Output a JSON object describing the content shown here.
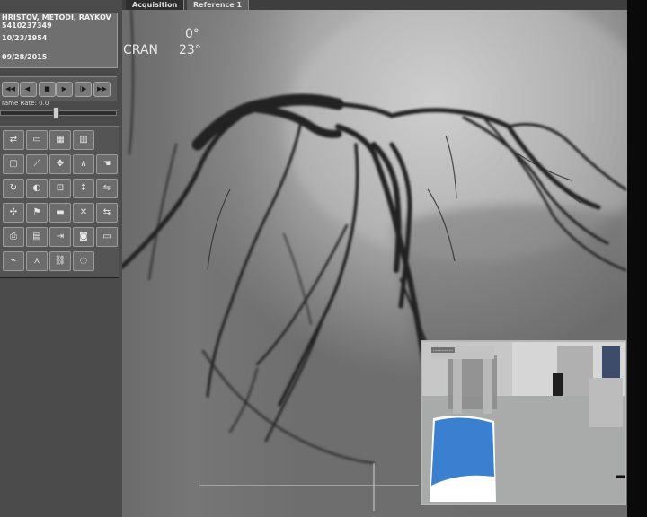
{
  "patient": {
    "name": "HRISTOV, METODI, RAYKOV",
    "id": "5410237349",
    "birth_date": "10/23/1954",
    "study_date": "09/28/2015"
  },
  "tabs": [
    {
      "label": "Acquisition",
      "active": true
    },
    {
      "label": "Reference 1",
      "active": false
    }
  ],
  "player": {
    "controls": [
      {
        "name": "rewind-icon",
        "glyph": "◀◀"
      },
      {
        "name": "step-back-icon",
        "glyph": "◀|"
      },
      {
        "name": "stop-icon",
        "glyph": "■"
      },
      {
        "name": "play-icon",
        "glyph": "▶"
      },
      {
        "name": "step-forward-icon",
        "glyph": "|▶"
      },
      {
        "name": "fast-forward-icon",
        "glyph": "▶▶"
      }
    ],
    "frame_rate_label": "rame Rate: 0.0",
    "frame_rate_slider_fraction": 0.47
  },
  "tools": [
    {
      "name": "layout-icon",
      "glyph": "⇄"
    },
    {
      "name": "folder-icon",
      "glyph": "▭"
    },
    {
      "name": "film-icon",
      "glyph": "▦"
    },
    {
      "name": "film-stack-icon",
      "glyph": "▥"
    },
    {
      "name": "",
      "glyph": ""
    },
    {
      "name": "comment-icon",
      "glyph": "▢"
    },
    {
      "name": "ruler-icon",
      "glyph": "⟋"
    },
    {
      "name": "move-icon",
      "glyph": "✥"
    },
    {
      "name": "measure-angle-icon",
      "glyph": "∧"
    },
    {
      "name": "hand-icon",
      "glyph": "☚"
    },
    {
      "name": "annotation-icon",
      "glyph": "↻"
    },
    {
      "name": "contrast-icon",
      "glyph": "◐"
    },
    {
      "name": "zoom-icon",
      "glyph": "⊡"
    },
    {
      "name": "pointer-icon",
      "glyph": "↕"
    },
    {
      "name": "flip-icon",
      "glyph": "⇋"
    },
    {
      "name": "pan-icon",
      "glyph": "✣"
    },
    {
      "name": "flag-icon",
      "glyph": "⚑"
    },
    {
      "name": "folder-open-icon",
      "glyph": "▬"
    },
    {
      "name": "close-icon",
      "glyph": "✕"
    },
    {
      "name": "reset-icon",
      "glyph": "⇆"
    },
    {
      "name": "print-icon",
      "glyph": "⎙"
    },
    {
      "name": "document-icon",
      "glyph": "▤"
    },
    {
      "name": "export-icon",
      "glyph": "⇥"
    },
    {
      "name": "camera-icon",
      "glyph": "◙"
    },
    {
      "name": "monitor-icon",
      "glyph": "▭"
    },
    {
      "name": "ecg-icon",
      "glyph": "⌁"
    },
    {
      "name": "vessel-icon",
      "glyph": "⋏"
    },
    {
      "name": "link-icon",
      "glyph": "⛓"
    },
    {
      "name": "balloon-icon",
      "glyph": "◌"
    },
    {
      "name": "",
      "glyph": ""
    }
  ],
  "overlay": {
    "angle_primary": "0°",
    "angle_secondary_label": "CRAN",
    "angle_secondary_value": "23°"
  },
  "inset": {
    "caption": "..............",
    "colors": {
      "table_blue": "#3a7fd0",
      "wall": "#c9c9c9"
    }
  }
}
